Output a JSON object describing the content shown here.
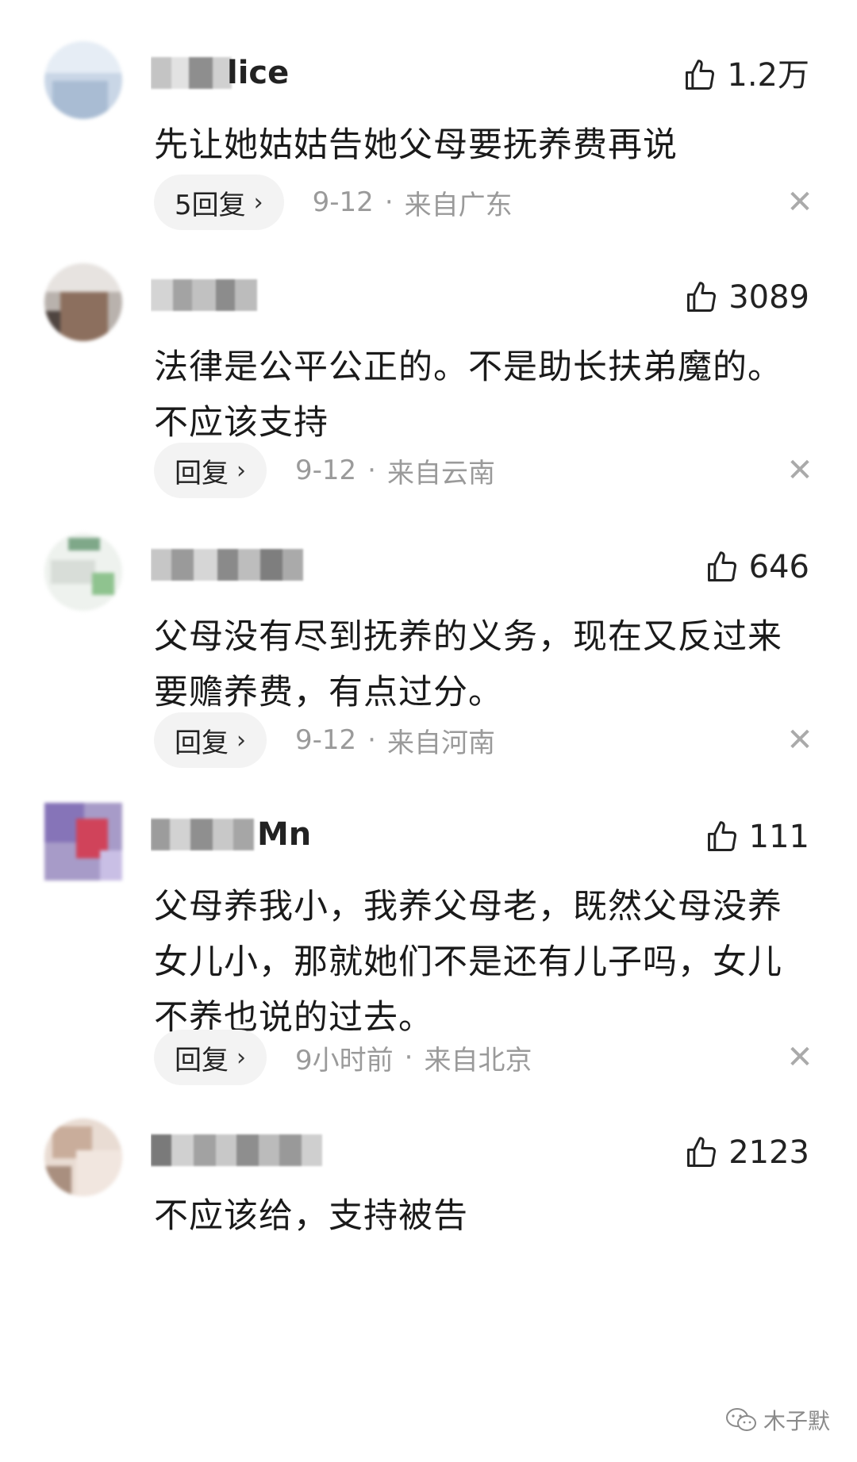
{
  "comments": [
    {
      "username_visible": "lice",
      "likes": "1.2万",
      "text": "先让她姑姑告她父母要抚养费再说",
      "reply_label": "5回复",
      "date": "9-12",
      "location": "来自广东"
    },
    {
      "username_visible": "",
      "likes": "3089",
      "text": "法律是公平公正的。不是助长扶弟魔的。不应该支持",
      "reply_label": "回复",
      "date": "9-12",
      "location": "来自云南"
    },
    {
      "username_visible": "",
      "likes": "646",
      "text": "父母没有尽到抚养的义务，现在又反过来要赡养费，有点过分。",
      "reply_label": "回复",
      "date": "9-12",
      "location": "来自河南"
    },
    {
      "username_visible": "Mn",
      "likes": "111",
      "text": "父母养我小，我养父母老，既然父母没养女儿小，那就她们不是还有儿子吗，女儿不养也说的过去。",
      "reply_label": "回复",
      "date": "9小时前",
      "location": "来自北京"
    },
    {
      "username_visible": "",
      "likes": "2123",
      "text": "不应该给，支持被告",
      "reply_label": "",
      "date": "",
      "location": ""
    }
  ],
  "meta_separator": "·",
  "reply_chevron": "›",
  "close_glyph": "✕",
  "watermark": {
    "text": "木子默",
    "icon": "wechat-icon"
  },
  "icons": {
    "like": "thumbs-up-icon",
    "close": "close-icon",
    "chevron": "chevron-right-icon"
  },
  "colors": {
    "text": "#1a1a1a",
    "meta": "#9a9a9a",
    "reply_bg": "#f3f3f3",
    "close": "#aaaaaa"
  }
}
